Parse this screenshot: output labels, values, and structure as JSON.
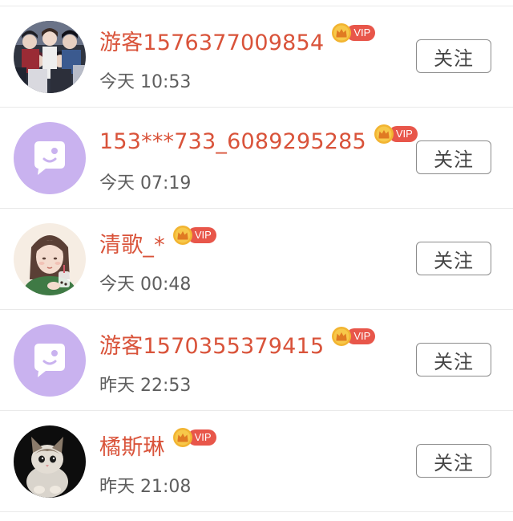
{
  "users": [
    {
      "name": "游客1576377009854",
      "time": "今天 10:53",
      "vip_label": "VIP",
      "follow_label": "关注",
      "avatar": "anime-group-avatar"
    },
    {
      "name": "153***733_6089295285",
      "time": "今天 07:19",
      "vip_label": "VIP",
      "follow_label": "关注",
      "avatar": "default-chat-bubble-avatar"
    },
    {
      "name": "清歌_*",
      "time": "今天 00:48",
      "vip_label": "VIP",
      "follow_label": "关注",
      "avatar": "illustrated-girl-avatar"
    },
    {
      "name": "游客1570355379415",
      "time": "昨天 22:53",
      "vip_label": "VIP",
      "follow_label": "关注",
      "avatar": "default-chat-bubble-avatar"
    },
    {
      "name": "橘斯琳",
      "time": "昨天 21:08",
      "vip_label": "VIP",
      "follow_label": "关注",
      "avatar": "cat-photo-avatar"
    }
  ],
  "colors": {
    "name": "#d9533a",
    "vip_pill": "#e8564a",
    "vip_crown": "#f2b431",
    "default_avatar_bg": "#c9b2ef"
  }
}
